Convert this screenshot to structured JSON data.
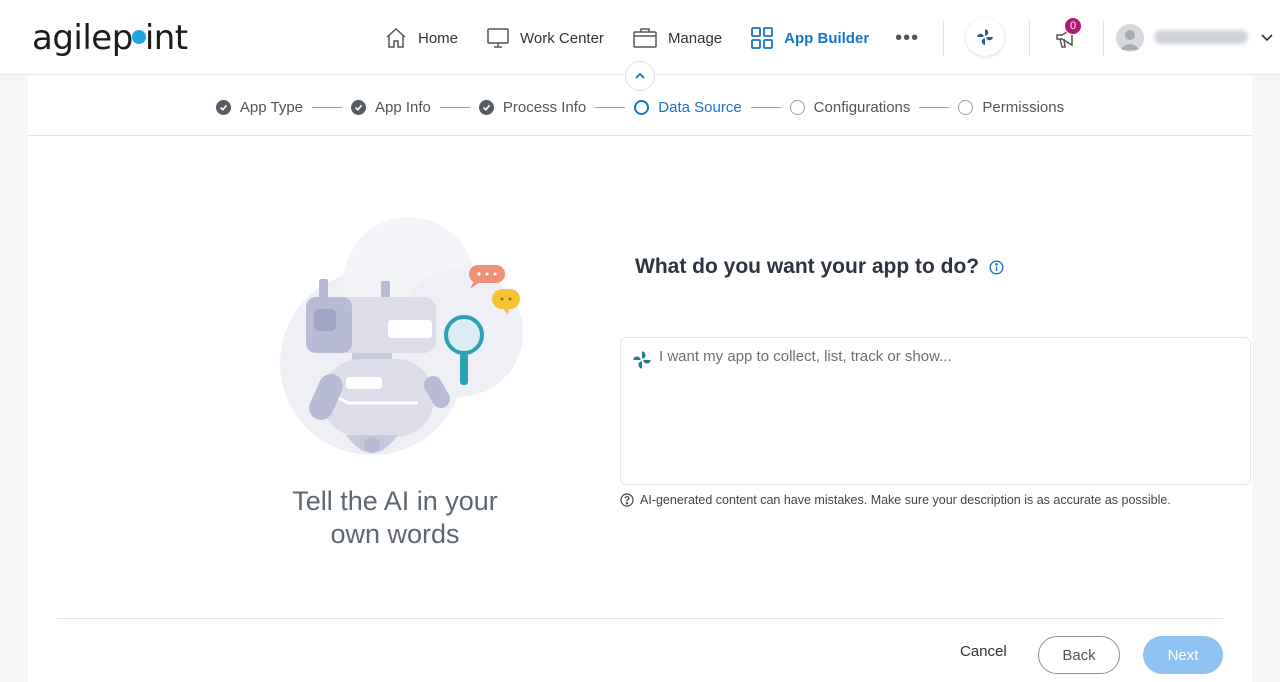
{
  "brand": {
    "logo_before": "agilep",
    "logo_after": "int"
  },
  "nav": {
    "items": [
      {
        "label": "Home",
        "icon": "home-icon"
      },
      {
        "label": "Work Center",
        "icon": "monitor-icon"
      },
      {
        "label": "Manage",
        "icon": "briefcase-icon"
      },
      {
        "label": "App Builder",
        "icon": "grid-icon"
      }
    ],
    "more": "•••"
  },
  "notifications": {
    "count": "0"
  },
  "stepper": {
    "steps": [
      {
        "label": "App Type",
        "state": "done"
      },
      {
        "label": "App Info",
        "state": "done"
      },
      {
        "label": "Process Info",
        "state": "done"
      },
      {
        "label": "Data Source",
        "state": "current"
      },
      {
        "label": "Configurations",
        "state": "todo"
      },
      {
        "label": "Permissions",
        "state": "todo"
      }
    ]
  },
  "illustration": {
    "tagline_line1": "Tell the AI in your",
    "tagline_line2": "own words"
  },
  "prompt": {
    "title": "What do you want your app to do?",
    "placeholder": "I want my app to collect, list, track or show...",
    "value": "",
    "disclaimer": "AI-generated content can have mistakes. Make sure your description is as accurate as possible."
  },
  "footer": {
    "cancel": "Cancel",
    "back": "Back",
    "next": "Next"
  },
  "colors": {
    "accent": "#1a73c9",
    "next_button": "#8ec3f2",
    "badge": "#b0187a",
    "ai_teal": "#1e7f86"
  }
}
